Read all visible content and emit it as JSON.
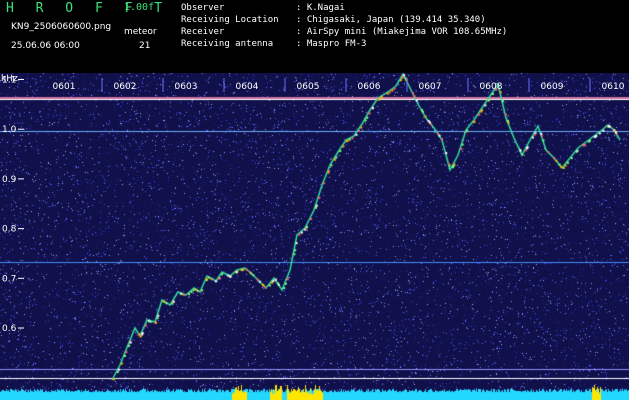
{
  "header": {
    "app_title": "H R O F F T",
    "version": "1.00f",
    "filename": "KN9_2506060600.png",
    "datetime": "25.06.06 06:00",
    "meteor_label": "meteor",
    "meteor_count": "21"
  },
  "info": [
    {
      "label": "Observer",
      "value": ": K.Nagai"
    },
    {
      "label": "Receiving Location",
      "value": ": Chigasaki, Japan (139.414 35.340)"
    },
    {
      "label": "Receiver",
      "value": ": AirSpy mini (Miakejima VOR 108.65MHz)"
    },
    {
      "label": "Receiving antenna",
      "value": ": Maspro FM-3"
    }
  ],
  "axes": {
    "y_unit": "kHz",
    "y_ticks": [
      "1.1",
      "1.0",
      "0.9",
      "0.8",
      "0.7",
      "0.6"
    ],
    "x_ticks": [
      "0601",
      "0602",
      "0603",
      "0604",
      "0605",
      "0606",
      "0607",
      "0608",
      "0609",
      "0610"
    ]
  },
  "colors": {
    "text": "#ffffff",
    "title": "#3ee07a",
    "background_noise": "#10104a",
    "grid": "#6a6aff",
    "trace": "#33e0a0",
    "bottom_bar": "#22d8ff",
    "burst": "#ffe600"
  }
}
